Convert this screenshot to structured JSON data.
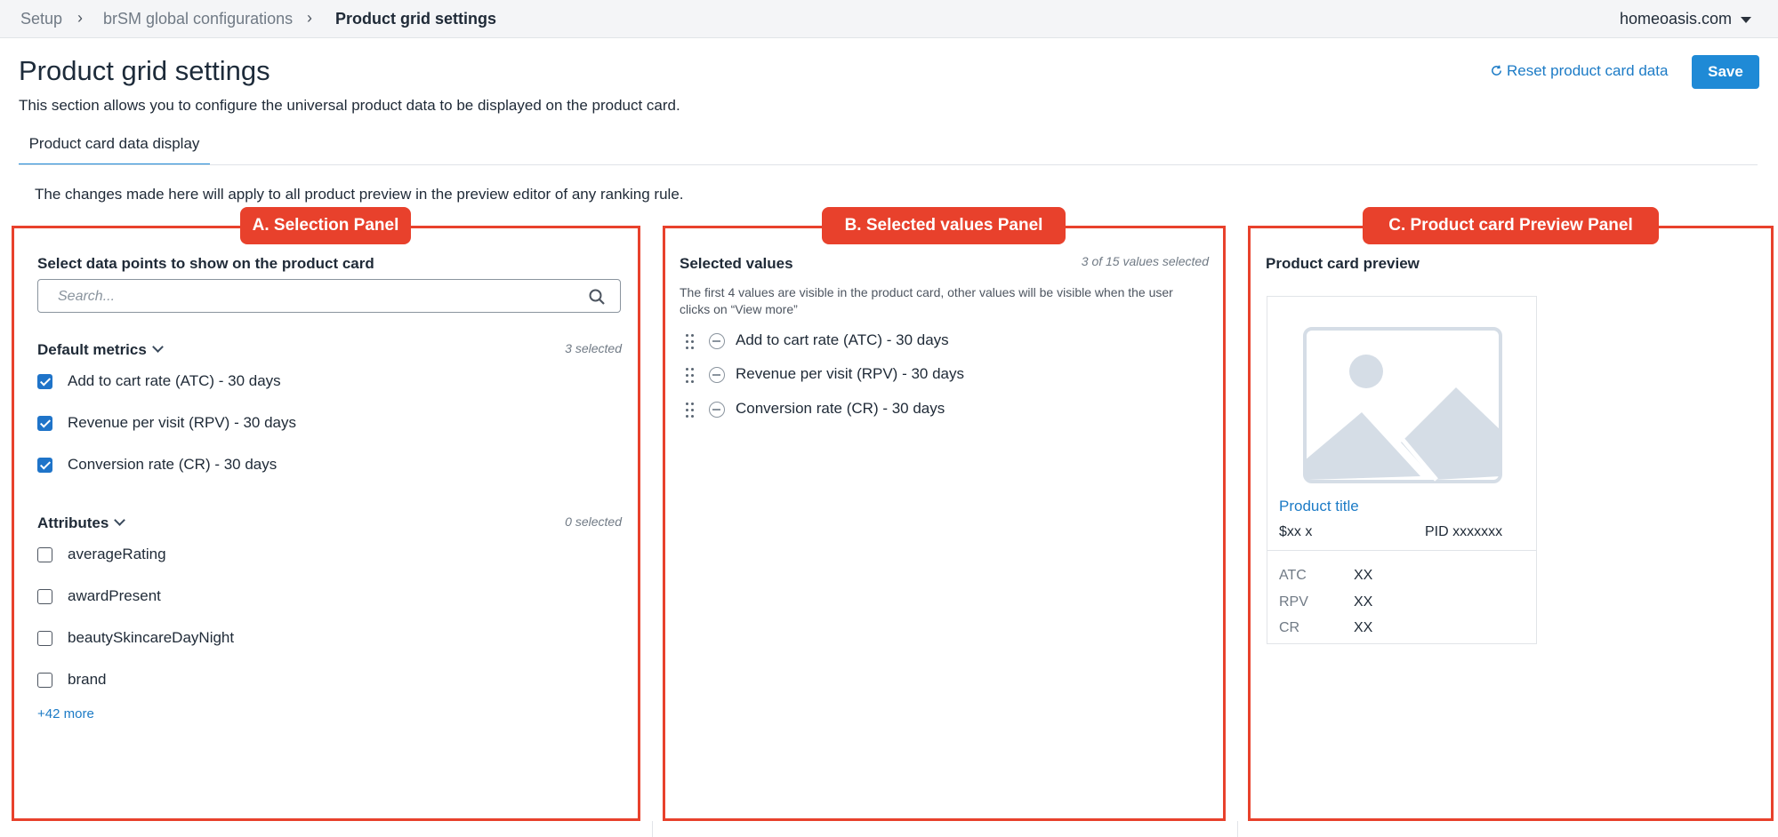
{
  "breadcrumb": [
    "Setup",
    "brSM global configurations",
    "Product grid settings"
  ],
  "account": "homeoasis.com",
  "page": {
    "title": "Product grid settings",
    "description": "This section allows you to configure the universal product data to be displayed on the product card.",
    "reset_label": "Reset product card data",
    "save_label": "Save",
    "tab_label": "Product card data display",
    "notice": "The changes made here will apply to all product preview in the preview editor of any ranking rule."
  },
  "annotations": {
    "a": "A. Selection Panel",
    "b": "B. Selected values Panel",
    "c": "C. Product card Preview Panel"
  },
  "selection": {
    "heading": "Select data points to show on the product card",
    "search_placeholder": "Search...",
    "default_metrics": {
      "title": "Default metrics",
      "count": "3 selected",
      "items": [
        {
          "label": "Add to cart rate (ATC) - 30 days",
          "checked": true
        },
        {
          "label": "Revenue per visit (RPV) - 30 days",
          "checked": true
        },
        {
          "label": "Conversion rate (CR) - 30 days",
          "checked": true
        }
      ]
    },
    "attributes": {
      "title": "Attributes",
      "count": "0 selected",
      "items": [
        {
          "label": "averageRating",
          "checked": false
        },
        {
          "label": "awardPresent",
          "checked": false
        },
        {
          "label": "beautySkincareDayNight",
          "checked": false
        },
        {
          "label": "brand",
          "checked": false
        }
      ],
      "more_label": "+42 more"
    }
  },
  "selected_values": {
    "heading": "Selected values",
    "count": "3 of 15 values selected",
    "help": "The first 4 values are visible in the product card, other values will be visible when the user clicks on “View more”",
    "items": [
      "Add to cart rate (ATC) - 30 days",
      "Revenue per visit (RPV) - 30 days",
      "Conversion rate (CR) - 30 days"
    ]
  },
  "preview": {
    "heading": "Product card preview",
    "product_title": "Product title",
    "price": "$xx x",
    "pid": "PID xxxxxxx",
    "metrics": [
      {
        "key": "ATC",
        "value": "XX"
      },
      {
        "key": "RPV",
        "value": "XX"
      },
      {
        "key": "CR",
        "value": "XX"
      }
    ]
  },
  "colors": {
    "accent": "#1f8ad6",
    "link": "#1c7bc6",
    "annotation": "#e8412c",
    "checkbox_on": "#1f74c9"
  }
}
